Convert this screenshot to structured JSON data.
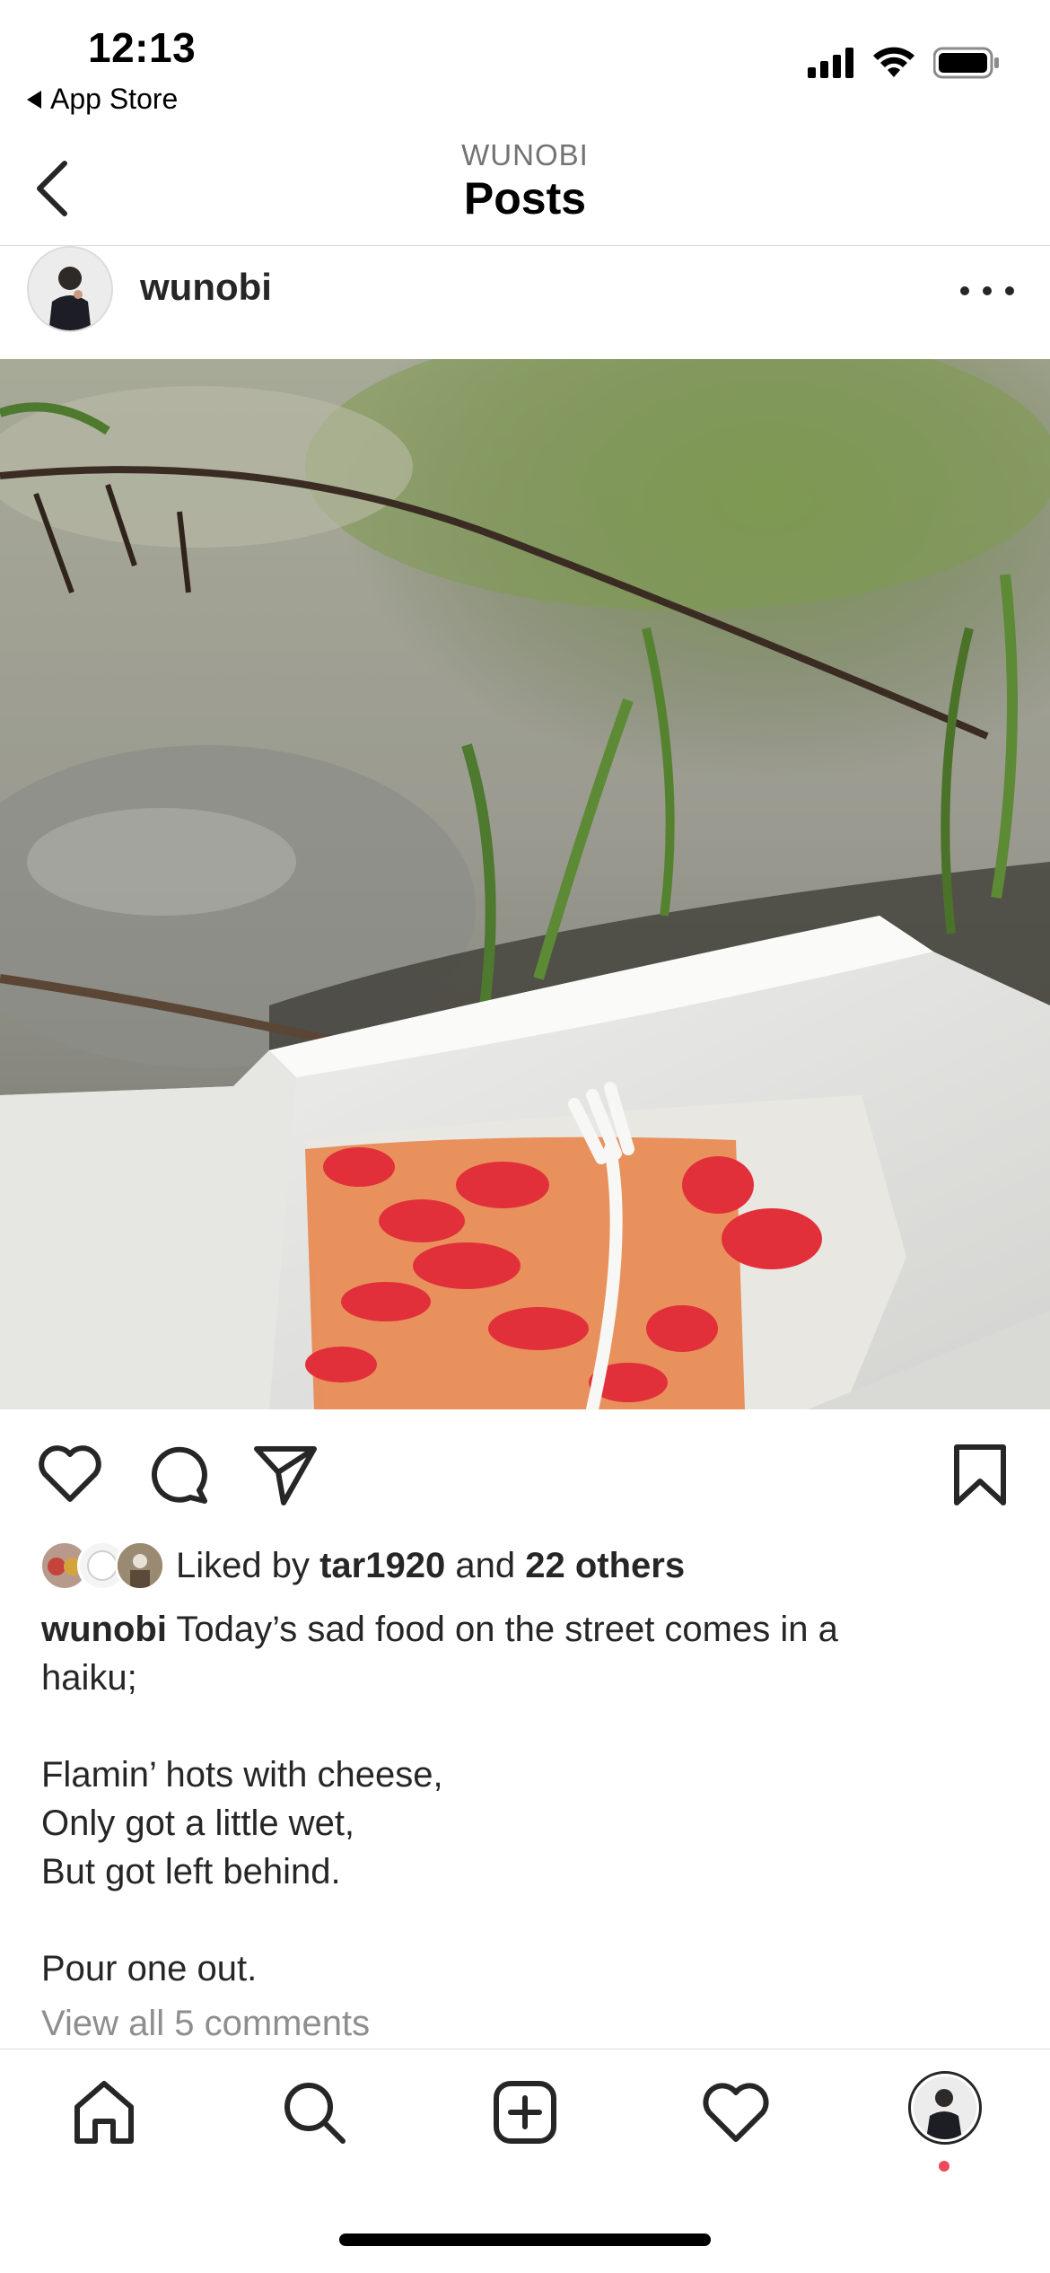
{
  "status_bar": {
    "time": "12:13",
    "back_app_label": "App Store",
    "icons": [
      "cellular-signal-icon",
      "wifi-icon",
      "battery-icon"
    ]
  },
  "nav": {
    "subtitle": "WUNOBI",
    "title": "Posts",
    "back_icon": "chevron-left-icon"
  },
  "post": {
    "username": "wunobi",
    "more_icon": "more-horizontal-icon",
    "photo_description_icon": "photo",
    "actions": [
      "heart-icon",
      "comment-icon",
      "send-icon",
      "bookmark-icon"
    ],
    "likes": {
      "prefix": "Liked by",
      "first_user": "tar1920",
      "conjunction": "and",
      "others": "22 others"
    },
    "caption": {
      "user": "wunobi",
      "text_line1": "Today’s sad food on the street comes in a",
      "text_line2": "haiku;",
      "poem_line1": "Flamin’ hots with cheese,",
      "poem_line2": "Only got a little wet,",
      "poem_line3": "But got left behind.",
      "closing": "Pour one out."
    },
    "view_comments": "View all 5 comments"
  },
  "tabbar": {
    "items": [
      "home-icon",
      "search-icon",
      "create-post-icon",
      "activity-heart-icon",
      "profile-avatar"
    ],
    "notification_color": "#ed4956"
  },
  "colors": {
    "text": "#262626",
    "secondary_text": "#8e8e8e",
    "divider": "#dbdbdb"
  }
}
